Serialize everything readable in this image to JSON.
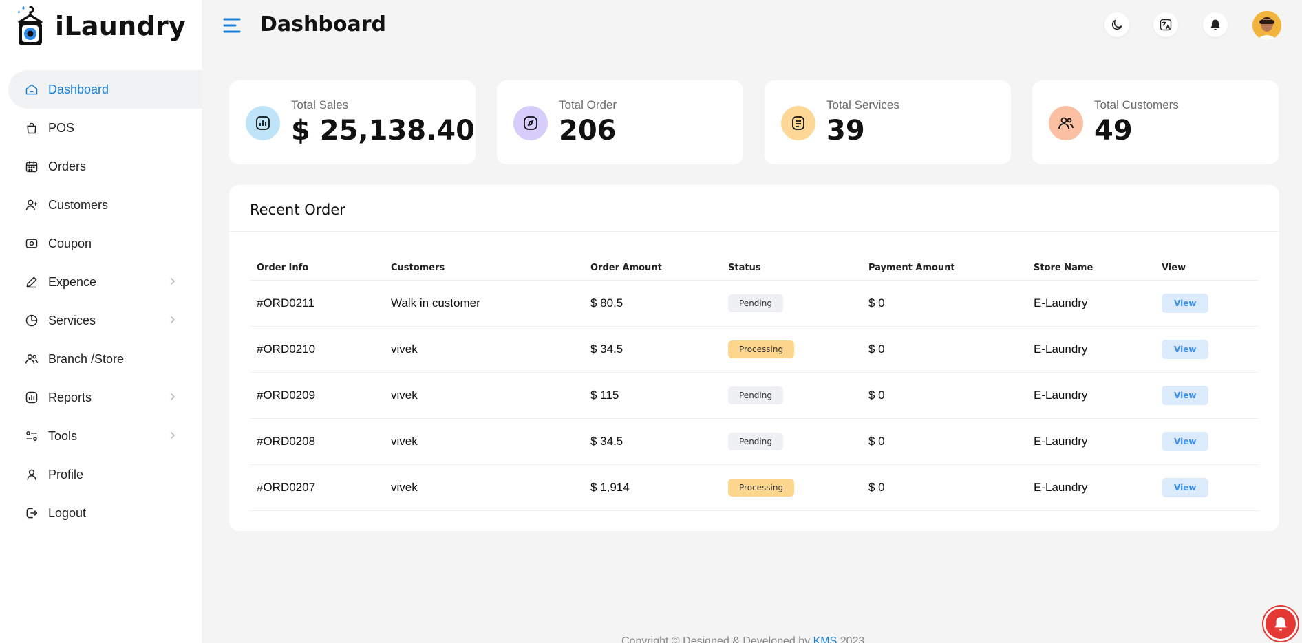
{
  "brand": {
    "name": "iLaundry"
  },
  "header": {
    "title": "Dashboard"
  },
  "sidebar": {
    "items": [
      {
        "label": "Dashboard",
        "icon": "home-icon",
        "active": true,
        "has_submenu": false
      },
      {
        "label": "POS",
        "icon": "bag-icon",
        "active": false,
        "has_submenu": false
      },
      {
        "label": "Orders",
        "icon": "calendar-icon",
        "active": false,
        "has_submenu": false
      },
      {
        "label": "Customers",
        "icon": "user-plus-icon",
        "active": false,
        "has_submenu": false
      },
      {
        "label": "Coupon",
        "icon": "ticket-icon",
        "active": false,
        "has_submenu": false
      },
      {
        "label": "Expence",
        "icon": "pen-icon",
        "active": false,
        "has_submenu": true
      },
      {
        "label": "Services",
        "icon": "pie-icon",
        "active": false,
        "has_submenu": true
      },
      {
        "label": "Branch /Store",
        "icon": "users-icon",
        "active": false,
        "has_submenu": false
      },
      {
        "label": "Reports",
        "icon": "chart-icon",
        "active": false,
        "has_submenu": true
      },
      {
        "label": "Tools",
        "icon": "sliders-icon",
        "active": false,
        "has_submenu": true
      },
      {
        "label": "Profile",
        "icon": "profile-icon",
        "active": false,
        "has_submenu": false
      },
      {
        "label": "Logout",
        "icon": "logout-icon",
        "active": false,
        "has_submenu": false
      }
    ]
  },
  "stats": [
    {
      "label": "Total Sales",
      "value": "$ 25,138.40",
      "icon": "chart-icon",
      "color": "#bfe4f8"
    },
    {
      "label": "Total Order",
      "value": "206",
      "icon": "compass-icon",
      "color": "#d6cdfb"
    },
    {
      "label": "Total Services",
      "value": "39",
      "icon": "document-icon",
      "color": "#fdd796"
    },
    {
      "label": "Total Customers",
      "value": "49",
      "icon": "users-icon",
      "color": "#fbbfa3"
    }
  ],
  "recent_orders": {
    "title": "Recent Order",
    "columns": [
      "Order Info",
      "Customers",
      "Order Amount",
      "Status",
      "Payment Amount",
      "Store Name",
      "View"
    ],
    "rows": [
      {
        "order": "#ORD0211",
        "customer": "Walk in customer",
        "amount": "$ 80.5",
        "status": "Pending",
        "payment": "$ 0",
        "store": "E-Laundry",
        "view": "View"
      },
      {
        "order": "#ORD0210",
        "customer": "vivek",
        "amount": "$ 34.5",
        "status": "Processing",
        "payment": "$ 0",
        "store": "E-Laundry",
        "view": "View"
      },
      {
        "order": "#ORD0209",
        "customer": "vivek",
        "amount": "$ 115",
        "status": "Pending",
        "payment": "$ 0",
        "store": "E-Laundry",
        "view": "View"
      },
      {
        "order": "#ORD0208",
        "customer": "vivek",
        "amount": "$ 34.5",
        "status": "Pending",
        "payment": "$ 0",
        "store": "E-Laundry",
        "view": "View"
      },
      {
        "order": "#ORD0207",
        "customer": "vivek",
        "amount": "$ 1,914",
        "status": "Processing",
        "payment": "$ 0",
        "store": "E-Laundry",
        "view": "View"
      }
    ]
  },
  "footer": {
    "prefix": "Copyright © Designed & Developed by ",
    "link": "KMS",
    "year": " 2023"
  },
  "colors": {
    "accent": "#1a7fd4",
    "pending_bg": "#eef0f3",
    "processing_bg": "#fcd68c",
    "view_bg": "#dcebfb",
    "alert": "#e53935"
  },
  "header_icons": [
    "moon-icon",
    "translate-icon",
    "bell-icon",
    "avatar"
  ]
}
